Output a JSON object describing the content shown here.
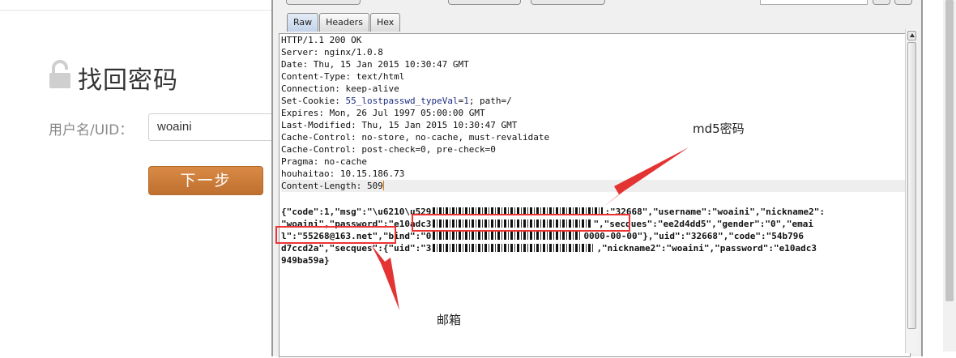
{
  "page": {
    "title": "找回密码",
    "uid_label": "用户名/UID：",
    "uid_value": "woaini",
    "next_button": "下一步"
  },
  "burp": {
    "tabs": [
      {
        "label": "Raw",
        "active": true
      },
      {
        "label": "Headers",
        "active": false
      },
      {
        "label": "Hex",
        "active": false
      }
    ],
    "headers": [
      "HTTP/1.1 200 OK",
      "Server: nginx/1.0.8",
      "Date: Thu, 15 Jan 2015 10:30:47 GMT",
      "Content-Type: text/html",
      "Connection: keep-alive",
      "Set-Cookie: ",
      "Expires: Mon, 26 Jul 1997 05:00:00 GMT",
      "Last-Modified: Thu, 15 Jan 2015 10:30:47 GMT",
      "Cache-Control: no-store, no-cache, must-revalidate",
      "Cache-Control: post-check=0, pre-check=0",
      "Pragma: no-cache",
      "houhaitao: 10.15.186.73",
      "Content-Length: 509"
    ],
    "cookie": {
      "name": "55_lostpasswd_typeVal",
      "eq": "=",
      "value": "1",
      "rest": "; path=/"
    },
    "body_lines": [
      {
        "a": "{\"code\":1,\"msg\":\"\\u6210\\u529",
        "b": ":\"32668\",\"username\":\"woaini\",\"nickname2\":"
      },
      {
        "a": "\"woaini\",\"password\":\"e10adc3",
        "b": "\",\"secques\":\"ee2d4dd5\",\"gender\":\"0\",\"emai"
      },
      {
        "a": "l\":\"55268@163.net\",\"bind\":\"0",
        "b": "0000-00-00\"},\"uid\":\"32668\",\"code\":\"54b796"
      },
      {
        "a": "d7ccd2a\",\"secques\":{\"uid\":\"3",
        "b": ",\"nickname2\":\"woaini\",\"password\":\"e10adc3"
      },
      {
        "a": "949ba59a}",
        "b": ""
      }
    ]
  },
  "annotations": {
    "md5_label": "md5密码",
    "email_label": "邮箱",
    "color": "#e33333"
  }
}
